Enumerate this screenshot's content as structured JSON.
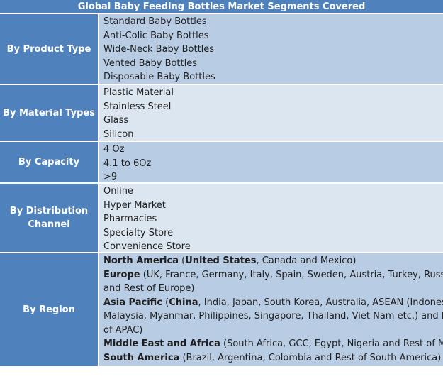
{
  "title": "Global Baby Feeding Bottles Market Segments Covered",
  "rows": [
    {
      "label": "By Product Type",
      "items": [
        "Standard Baby Bottles",
        "Anti-Colic Baby Bottles",
        "Wide-Neck Baby Bottles",
        "Vented Baby Bottles",
        "Disposable Baby Bottles"
      ]
    },
    {
      "label": "By Material Types",
      "items": [
        "Plastic Material",
        "Stainless Steel",
        "Glass",
        "Silicon"
      ]
    },
    {
      "label": "By Capacity",
      "items": [
        "4 Oz",
        "4.1 to 6Oz",
        ">9"
      ]
    },
    {
      "label_line1": "By Distribution",
      "label_line2": "Channel",
      "items": [
        "Online",
        "Hyper Market",
        "Pharmacies",
        "Specialty Store",
        "Convenience Store"
      ]
    },
    {
      "label": "By Region",
      "regions": {
        "north_america": {
          "name": "North America",
          "open": " (",
          "first": "United States",
          "rest": ", Canada and Mexico)"
        },
        "europe": {
          "name": "Europe",
          "line1_rest": " (UK, France, Germany, Italy, Spain, Sweden, Austria, Turkey, Russia",
          "line2": "and Rest of Europe)"
        },
        "asia_pacific": {
          "name": "Asia Pacific",
          "open": " (",
          "first": "China",
          "line1_rest": ", India, Japan, South Korea, Australia, ASEAN (Indonesia,",
          "line2": "Malaysia, Myanmar, Philippines, Singapore, Thailand, Viet Nam etc.) and Rest",
          "line3": "of APAC)"
        },
        "mea": {
          "name": "Middle East and Africa",
          "rest": " (South Africa, GCC, Egypt, Nigeria and Rest of MEA)"
        },
        "south_america": {
          "name": "South America",
          "rest": " (Brazil, Argentina, Colombia and Rest of South America)"
        }
      }
    }
  ],
  "colors": {
    "header_blue": "#4f81bd",
    "cell_dark": "#b8cce4",
    "cell_light": "#dce6f1",
    "text": "#1f1f1f"
  }
}
